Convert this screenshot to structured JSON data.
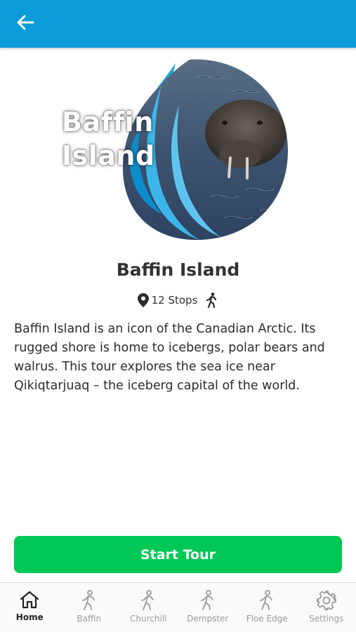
{
  "header": {
    "back_icon": "arrow-left-icon",
    "background": "#0a9bd8"
  },
  "hero": {
    "title_line1": "Baffin",
    "title_line2": "Island",
    "image": "walrus-in-water-with-blue-flame-logo"
  },
  "tour": {
    "title": "Baffin Island",
    "stops": "12 Stops",
    "stops_icon": "map-pin-icon",
    "mode_icon": "walking-icon",
    "description": "Baffin Island is an icon of the Canadian Arctic. Its rugged shore is home to icebergs, polar bears and walrus. This tour explores the sea ice near Qikiqtarjuaq – the iceberg capital of the world."
  },
  "actions": {
    "start_label": "Start Tour",
    "start_color": "#00c856"
  },
  "tabbar": {
    "items": [
      {
        "label": "Home",
        "icon": "home-icon",
        "active": true
      },
      {
        "label": "Baffin",
        "icon": "walking-icon",
        "active": false
      },
      {
        "label": "Churchill",
        "icon": "walking-icon",
        "active": false
      },
      {
        "label": "Dempster",
        "icon": "walking-icon",
        "active": false
      },
      {
        "label": "Floe Edge",
        "icon": "walking-icon",
        "active": false
      },
      {
        "label": "Settings",
        "icon": "gear-icon",
        "active": false
      }
    ]
  }
}
